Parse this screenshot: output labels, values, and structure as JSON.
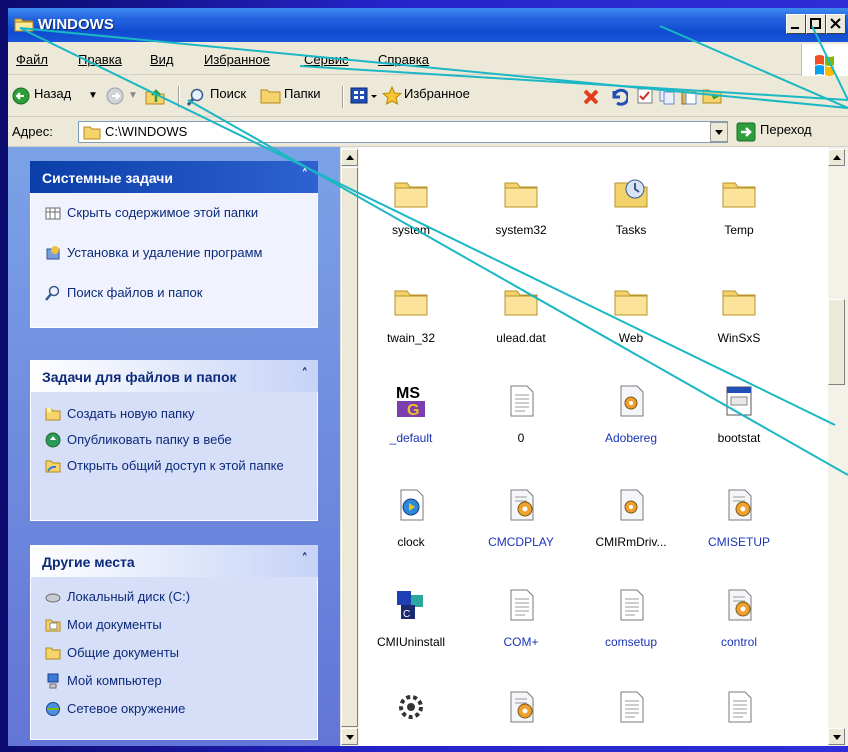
{
  "window": {
    "title": "WINDOWS"
  },
  "menu": [
    "Файл",
    "Правка",
    "Вид",
    "Избранное",
    "Сервис",
    "Справка"
  ],
  "toolbar": {
    "back": "Назад",
    "search": "Поиск",
    "folders": "Папки",
    "favorites": "Избранное"
  },
  "address": {
    "label": "Адрес:",
    "value": "C:\\WINDOWS",
    "go": "Переход"
  },
  "panels": {
    "system": {
      "title": "Системные задачи",
      "items": [
        "Скрыть содержимое этой папки",
        "Установка и удаление программ",
        "Поиск файлов и папок"
      ]
    },
    "files": {
      "title": "Задачи для файлов и папок",
      "items": [
        "Создать новую папку",
        "Опубликовать папку в вебе",
        "Открыть общий доступ к этой папке"
      ]
    },
    "places": {
      "title": "Другие места",
      "items": [
        "Локальный диск (C:)",
        "Мои документы",
        "Общие документы",
        "Мой компьютер",
        "Сетевое окружение"
      ]
    }
  },
  "files": [
    {
      "name": "system",
      "icon": "folder-icon",
      "color": "#000000"
    },
    {
      "name": "system32",
      "icon": "folder-icon",
      "color": "#000000"
    },
    {
      "name": "Tasks",
      "icon": "tasks-folder-icon",
      "color": "#000000"
    },
    {
      "name": "Temp",
      "icon": "folder-icon",
      "color": "#000000"
    },
    {
      "name": "twain_32",
      "icon": "folder-icon",
      "color": "#000000"
    },
    {
      "name": "ulead.dat",
      "icon": "folder-icon",
      "color": "#000000"
    },
    {
      "name": "Web",
      "icon": "folder-icon",
      "color": "#000000"
    },
    {
      "name": "WinSxS",
      "icon": "folder-icon",
      "color": "#000000"
    },
    {
      "name": "_default",
      "icon": "ms-dos-icon",
      "color": "#1a34b8"
    },
    {
      "name": "0",
      "icon": "text-file-icon",
      "color": "#000000"
    },
    {
      "name": "Adobereg",
      "icon": "config-file-icon",
      "color": "#1a34b8"
    },
    {
      "name": "bootstat",
      "icon": "dat-file-icon",
      "color": "#000000"
    },
    {
      "name": "clock",
      "icon": "media-file-icon",
      "color": "#000000"
    },
    {
      "name": "CMCDPLAY",
      "icon": "settings-file-icon",
      "color": "#1a34b8"
    },
    {
      "name": "CMIRmDriv...",
      "icon": "config-file-icon",
      "color": "#000000"
    },
    {
      "name": "CMISETUP",
      "icon": "settings-file-icon",
      "color": "#1a34b8"
    },
    {
      "name": "CMIUninstall",
      "icon": "app-icon",
      "color": "#000000"
    },
    {
      "name": "COM+",
      "icon": "text-file-icon",
      "color": "#1a34b8"
    },
    {
      "name": "comsetup",
      "icon": "text-file-icon",
      "color": "#1a34b8"
    },
    {
      "name": "control",
      "icon": "settings-file-icon",
      "color": "#1a34b8"
    },
    {
      "name": "",
      "icon": "phone-icon",
      "color": "#000000"
    },
    {
      "name": "",
      "icon": "settings-file-icon",
      "color": "#000000"
    },
    {
      "name": "",
      "icon": "text-file-icon",
      "color": "#000000"
    },
    {
      "name": "",
      "icon": "text-file-icon",
      "color": "#000000"
    }
  ],
  "colors": {
    "titlebar": "#0f4bd0",
    "panel_link": "#0c2a7a",
    "annotation_line": "#1ab7c4"
  }
}
